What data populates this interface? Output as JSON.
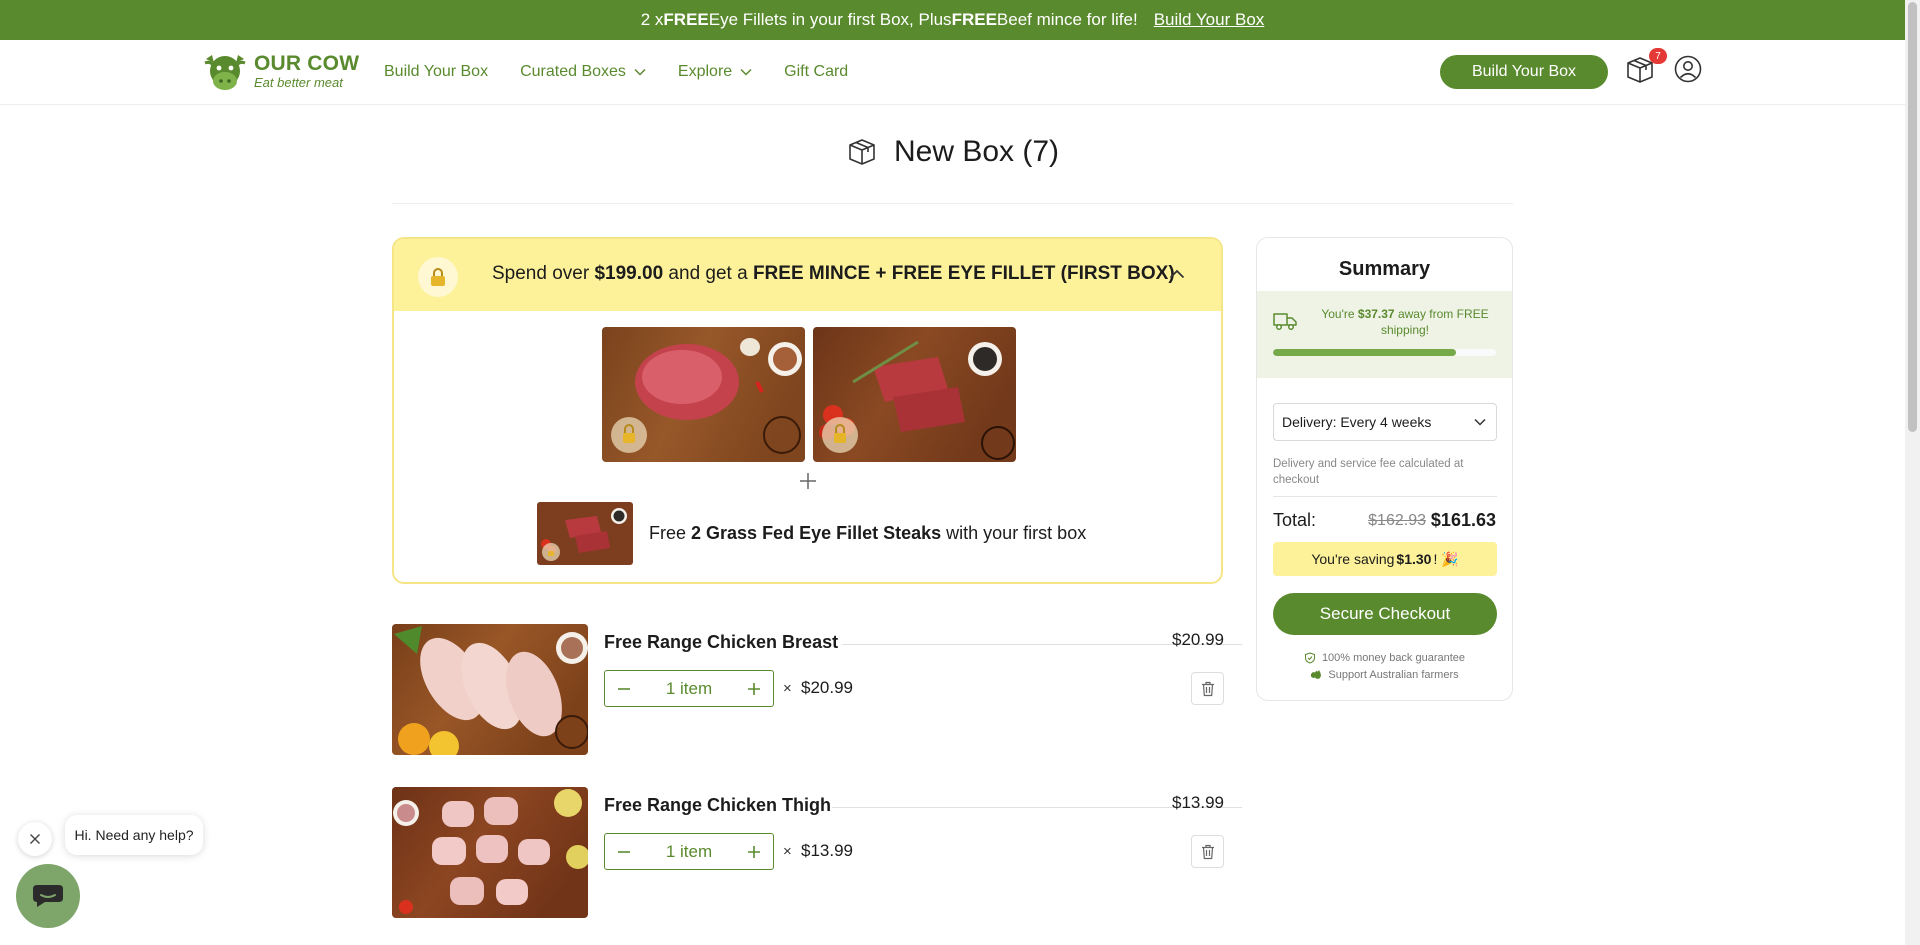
{
  "announcement": {
    "prefix": "2 x ",
    "free1": "FREE",
    "mid": " Eye Fillets in your first Box, Plus ",
    "free2": "FREE",
    "suffix": " Beef mince for life!",
    "link": "Build Your Box"
  },
  "header": {
    "logo_title": "OUR COW",
    "logo_sub": "Eat better meat",
    "nav": [
      {
        "label": "Build Your Box",
        "dropdown": false
      },
      {
        "label": "Curated Boxes",
        "dropdown": true
      },
      {
        "label": "Explore",
        "dropdown": true
      },
      {
        "label": "Gift Card",
        "dropdown": false
      }
    ],
    "cta": "Build Your Box",
    "cart_count": "7",
    "icons": {
      "cart": "box-icon",
      "account": "user-icon"
    }
  },
  "page": {
    "title": "New Box (7)"
  },
  "promo": {
    "text_prefix": "Spend over ",
    "amount": "$199.00",
    "text_mid": " and get a ",
    "offer": "FREE MINCE + FREE EYE FILLET (FIRST BOX)",
    "free_prefix": "Free ",
    "free_bold": "2 Grass Fed Eye Fillet Steaks",
    "free_suffix": " with your first box",
    "images": [
      "beef-mince-image",
      "eye-fillet-image"
    ]
  },
  "items": [
    {
      "name": "Free Range Chicken Breast",
      "price": "$20.99",
      "qty": "1 item",
      "times": "×",
      "unit_price": "$20.99"
    },
    {
      "name": "Free Range Chicken Thigh",
      "price": "$13.99",
      "qty": "1 item",
      "times": "×",
      "unit_price": "$13.99"
    }
  ],
  "summary": {
    "title": "Summary",
    "ship_prefix": "You're ",
    "ship_amount": "$37.37",
    "ship_suffix": " away from FREE shipping!",
    "ship_progress": 0.82,
    "delivery": "Delivery: Every 4 weeks",
    "fee_note": "Delivery and service fee calculated at checkout",
    "total_label": "Total:",
    "total_old": "$162.93",
    "total_new": "$161.63",
    "saving_prefix": "You're saving ",
    "saving_amount": "$1.30",
    "saving_suffix": "! 🎉",
    "checkout": "Secure Checkout",
    "guarantee1": "100% money back guarantee",
    "guarantee2": "Support Australian farmers"
  },
  "chat": {
    "message": "Hi. Need any help?"
  },
  "colors": {
    "brand": "#5a8a2e",
    "promo_yellow": "#fdf29a",
    "badge": "#e53935"
  }
}
